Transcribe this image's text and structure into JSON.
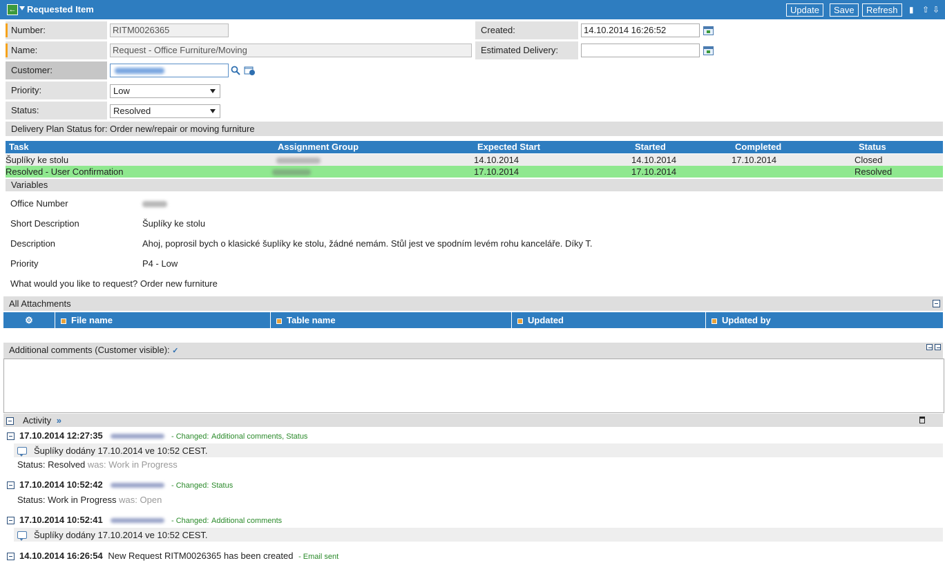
{
  "header": {
    "title": "Requested Item",
    "buttons": {
      "update": "Update",
      "save": "Save",
      "refresh": "Refresh"
    }
  },
  "form": {
    "number": {
      "label": "Number:",
      "value": "RITM0026365"
    },
    "name": {
      "label": "Name:",
      "value": "Request - Office Furniture/Moving"
    },
    "customer": {
      "label": "Customer:"
    },
    "priority": {
      "label": "Priority:",
      "value": "Low"
    },
    "status": {
      "label": "Status:",
      "value": "Resolved"
    },
    "created": {
      "label": "Created:",
      "value": "14.10.2014 16:26:52"
    },
    "estimated_delivery": {
      "label": "Estimated Delivery:",
      "value": ""
    }
  },
  "delivery_plan": {
    "title": "Delivery Plan Status for: Order new/repair or moving furniture",
    "columns": [
      "Task",
      "Assignment Group",
      "Expected Start",
      "Started",
      "Completed",
      "Status"
    ],
    "rows": [
      {
        "task": "Šuplíky ke stolu",
        "expected_start": "14.10.2014",
        "started": "14.10.2014",
        "completed": "17.10.2014",
        "status": "Closed"
      },
      {
        "task": "Resolved - User Confirmation",
        "expected_start": "17.10.2014",
        "started": "17.10.2014",
        "completed": "",
        "status": "Resolved"
      }
    ]
  },
  "variables": {
    "title": "Variables",
    "items": [
      {
        "label": "Office Number",
        "value": ""
      },
      {
        "label": "Short Description",
        "value": "Šuplíky ke stolu"
      },
      {
        "label": "Description",
        "value": "Ahoj, poprosil bych o klasické šuplíky ke stolu, žádné nemám. Stůl jest ve spodním levém rohu kanceláře. Díky T."
      },
      {
        "label": "Priority",
        "value": "P4 - Low"
      }
    ],
    "question": "What would you like to request? Order new furniture"
  },
  "attachments": {
    "title": "All Attachments",
    "columns": [
      "File name",
      "Table name",
      "Updated",
      "Updated by"
    ]
  },
  "comments": {
    "label": "Additional comments (Customer visible):",
    "value": ""
  },
  "activity": {
    "label": "Activity",
    "entries": [
      {
        "time": "17.10.2014 12:27:35",
        "changed": "- Changed:",
        "fields": "Additional comments, Status",
        "comment": "Šuplíky dodány 17.10.2014 ve 10:52 CEST.",
        "status_line": "Status: Resolved",
        "was": "was: Work in Progress"
      },
      {
        "time": "17.10.2014 10:52:42",
        "changed": "- Changed:",
        "fields": "Status",
        "status_line": "Status: Work in Progress",
        "was": "was: Open"
      },
      {
        "time": "17.10.2014 10:52:41",
        "changed": "- Changed:",
        "fields": "Additional comments",
        "comment": "Šuplíky dodány 17.10.2014 ve 10:52 CEST."
      },
      {
        "time": "14.10.2014 16:26:54",
        "text": "New Request RITM0026365 has been created",
        "note": "- Email sent"
      }
    ]
  },
  "colors": {
    "header": "#2e7dc0",
    "resolved_row": "#8fe88f",
    "mandatory": "#f5a31c",
    "changed_text": "#2a8a2a"
  }
}
